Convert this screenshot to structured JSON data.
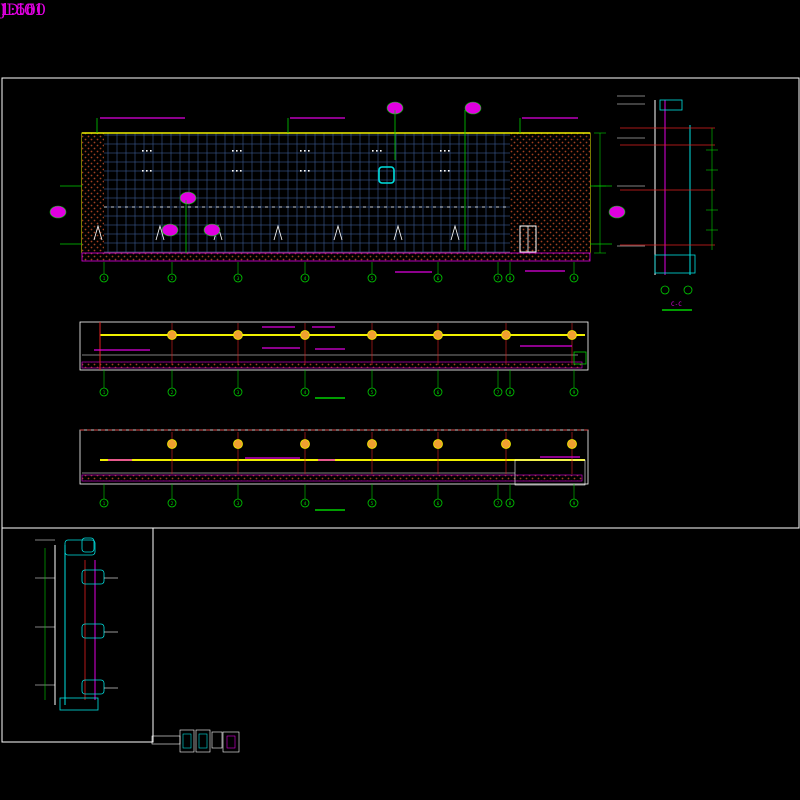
{
  "labels": {
    "scale_main": "1:150",
    "detail_code": "JD.01",
    "scale_detail": "1:50",
    "section_cc": "C-C"
  },
  "colors": {
    "background": "#000000",
    "frame": "#ffffff",
    "magenta": "#e000e0",
    "green": "#00d000",
    "yellow": "#f0f000",
    "cyan": "#00e0e0",
    "red": "#e02020",
    "brick": "#a04020",
    "grid": "#4a6aa0"
  },
  "grid_axes": [
    "1",
    "2",
    "3",
    "4",
    "5",
    "6",
    "7",
    "8",
    "9"
  ]
}
